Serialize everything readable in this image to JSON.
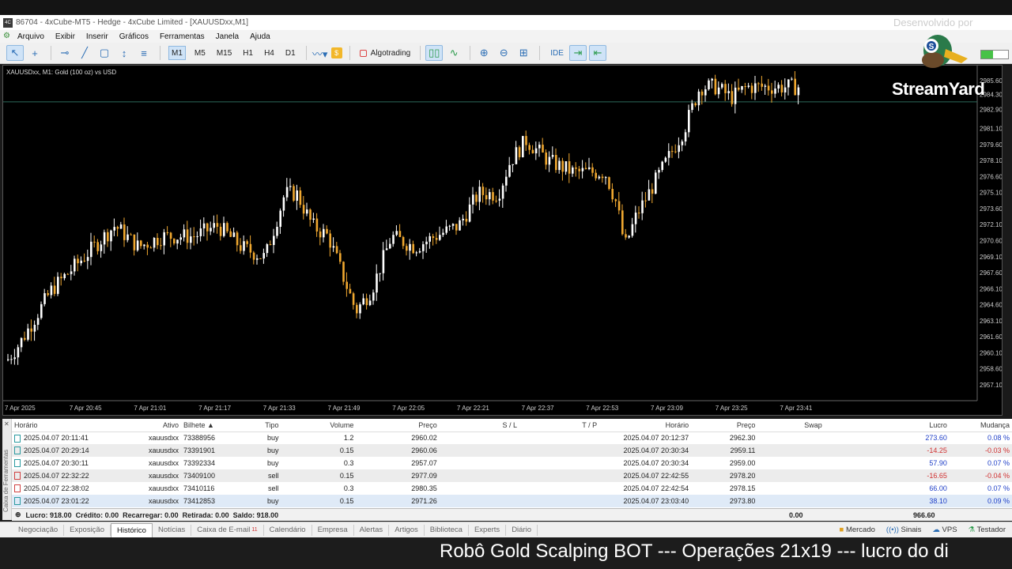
{
  "window": {
    "title": "86704 - 4xCube-MT5 - Hedge - 4xCube Limited - [XAUUSDxx,M1]"
  },
  "menu": [
    "Arquivo",
    "Exibir",
    "Inserir",
    "Gráficos",
    "Ferramentas",
    "Janela",
    "Ajuda"
  ],
  "toolbar": {
    "timeframes": [
      "M1",
      "M5",
      "M15",
      "H1",
      "H4",
      "D1"
    ],
    "active_timeframe": "M1",
    "algotrading_label": "Algotrading",
    "ide_label": "IDE"
  },
  "overlay": {
    "watermark": "Desenvolvido por",
    "streamyard": "StreamYard",
    "battery_level": 0.45
  },
  "chart": {
    "symbol_label": "XAUUSDxx, M1:  Gold (100 oz) vs USD",
    "price_ticks": [
      "2985.60",
      "2984.30",
      "2982.90",
      "2981.10",
      "2979.60",
      "2978.10",
      "2976.60",
      "2975.10",
      "2973.60",
      "2972.10",
      "2970.60",
      "2969.10",
      "2967.60",
      "2966.10",
      "2964.60",
      "2963.10",
      "2961.60",
      "2960.10",
      "2958.60",
      "2957.10"
    ],
    "time_ticks": [
      "7 Apr 2025",
      "7 Apr 20:45",
      "7 Apr 21:01",
      "7 Apr 21:17",
      "7 Apr 21:33",
      "7 Apr 21:49",
      "7 Apr 22:05",
      "7 Apr 22:21",
      "7 Apr 22:37",
      "7 Apr 22:53",
      "7 Apr 23:09",
      "7 Apr 23:25",
      "7 Apr 23:41"
    ],
    "up_color": "#ffffff",
    "down_color": "#f0a830"
  },
  "table": {
    "headers": [
      "Horário",
      "Ativo",
      "Bilhete",
      "Tipo",
      "Volume",
      "Preço",
      "S / L",
      "T / P",
      "Horário",
      "Preço",
      "Swap",
      "Lucro",
      "Mudança"
    ],
    "rows": [
      [
        "2025.04.07 20:11:41",
        "xauusdxx",
        "73388956",
        "buy",
        "1.2",
        "2960.02",
        "",
        "",
        "2025.04.07 20:12:37",
        "2962.30",
        "",
        "273.60",
        "0.08 %"
      ],
      [
        "2025.04.07 20:29:14",
        "xauusdxx",
        "73391901",
        "buy",
        "0.15",
        "2960.06",
        "",
        "",
        "2025.04.07 20:30:34",
        "2959.11",
        "",
        "-14.25",
        "-0.03 %"
      ],
      [
        "2025.04.07 20:30:11",
        "xauusdxx",
        "73392334",
        "buy",
        "0.3",
        "2957.07",
        "",
        "",
        "2025.04.07 20:30:34",
        "2959.00",
        "",
        "57.90",
        "0.07 %"
      ],
      [
        "2025.04.07 22:32:22",
        "xauusdxx",
        "73409100",
        "sell",
        "0.15",
        "2977.09",
        "",
        "",
        "2025.04.07 22:42:55",
        "2978.20",
        "",
        "-16.65",
        "-0.04 %"
      ],
      [
        "2025.04.07 22:38:02",
        "xauusdxx",
        "73410116",
        "sell",
        "0.3",
        "2980.35",
        "",
        "",
        "2025.04.07 22:42:54",
        "2978.15",
        "",
        "66.00",
        "0.07 %"
      ],
      [
        "2025.04.07 23:01:22",
        "xauusdxx",
        "73412853",
        "buy",
        "0.15",
        "2971.26",
        "",
        "",
        "2025.04.07 23:03:40",
        "2973.80",
        "",
        "38.10",
        "0.09 %"
      ]
    ]
  },
  "summary": {
    "text": "Lucro: 918.00  Crédito: 0.00  Recarregar: 0.00  Retirada: 0.00  Saldo: 918.00",
    "swap_total": "0.00",
    "profit_total": "966.60"
  },
  "dock_label": "Caixa de Ferramentas",
  "tabs": [
    {
      "label": "Negociação"
    },
    {
      "label": "Exposição"
    },
    {
      "label": "Histórico"
    },
    {
      "label": "Notícias"
    },
    {
      "label": "Caixa de E-mail",
      "badge": "11"
    },
    {
      "label": "Calendário"
    },
    {
      "label": "Empresa"
    },
    {
      "label": "Alertas"
    },
    {
      "label": "Artigos"
    },
    {
      "label": "Biblioteca"
    },
    {
      "label": "Experts"
    },
    {
      "label": "Diário"
    }
  ],
  "active_tab": "Histórico",
  "status": {
    "mercado": "Mercado",
    "sinais": "Sinais",
    "vps": "VPS",
    "testador": "Testador"
  },
  "ticker": "Robô Gold Scalping BOT --- Operações 21x19 --- lucro do di"
}
